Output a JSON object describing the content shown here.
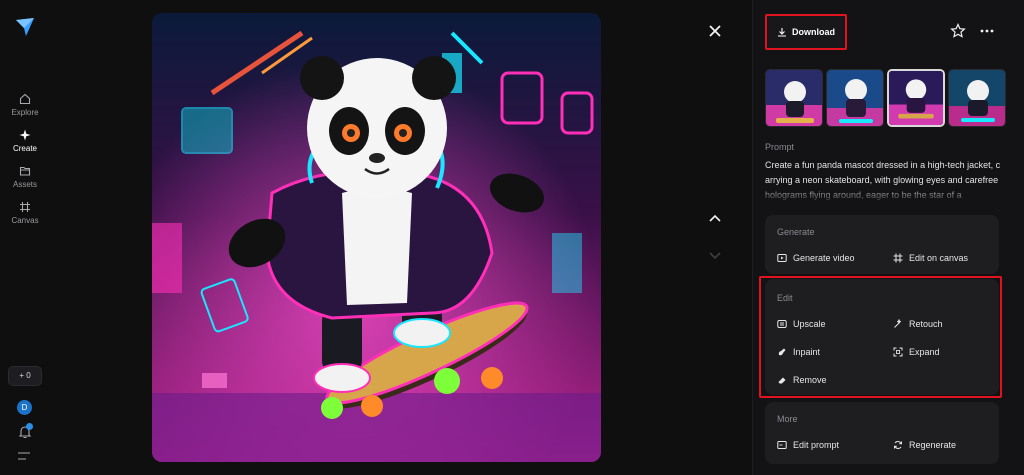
{
  "sidebar": {
    "items": [
      {
        "label": "Explore",
        "icon": "home-icon"
      },
      {
        "label": "Create",
        "icon": "sparkle-icon"
      },
      {
        "label": "Assets",
        "icon": "folder-icon"
      },
      {
        "label": "Canvas",
        "icon": "canvas-icon"
      }
    ],
    "credits": "+ 0",
    "avatar_initial": "D"
  },
  "toolbar": {
    "download_label": "Download"
  },
  "prompt": {
    "label": "Prompt",
    "text": "Create a fun panda mascot dressed in a high-tech jacket, carrying a neon skateboard, with glowing eyes and carefree holograms flying around, eager to be the star of a"
  },
  "generate": {
    "title": "Generate",
    "generate_video": "Generate video",
    "edit_on_canvas": "Edit on canvas"
  },
  "edit": {
    "title": "Edit",
    "upscale": "Upscale",
    "retouch": "Retouch",
    "inpaint": "Inpaint",
    "expand": "Expand",
    "remove": "Remove"
  },
  "more": {
    "title": "More",
    "edit_prompt": "Edit prompt",
    "regenerate": "Regenerate"
  },
  "colors": {
    "accent_red": "#e0141e",
    "neon_cyan": "#19e6ff",
    "neon_pink": "#ff2fb8"
  }
}
